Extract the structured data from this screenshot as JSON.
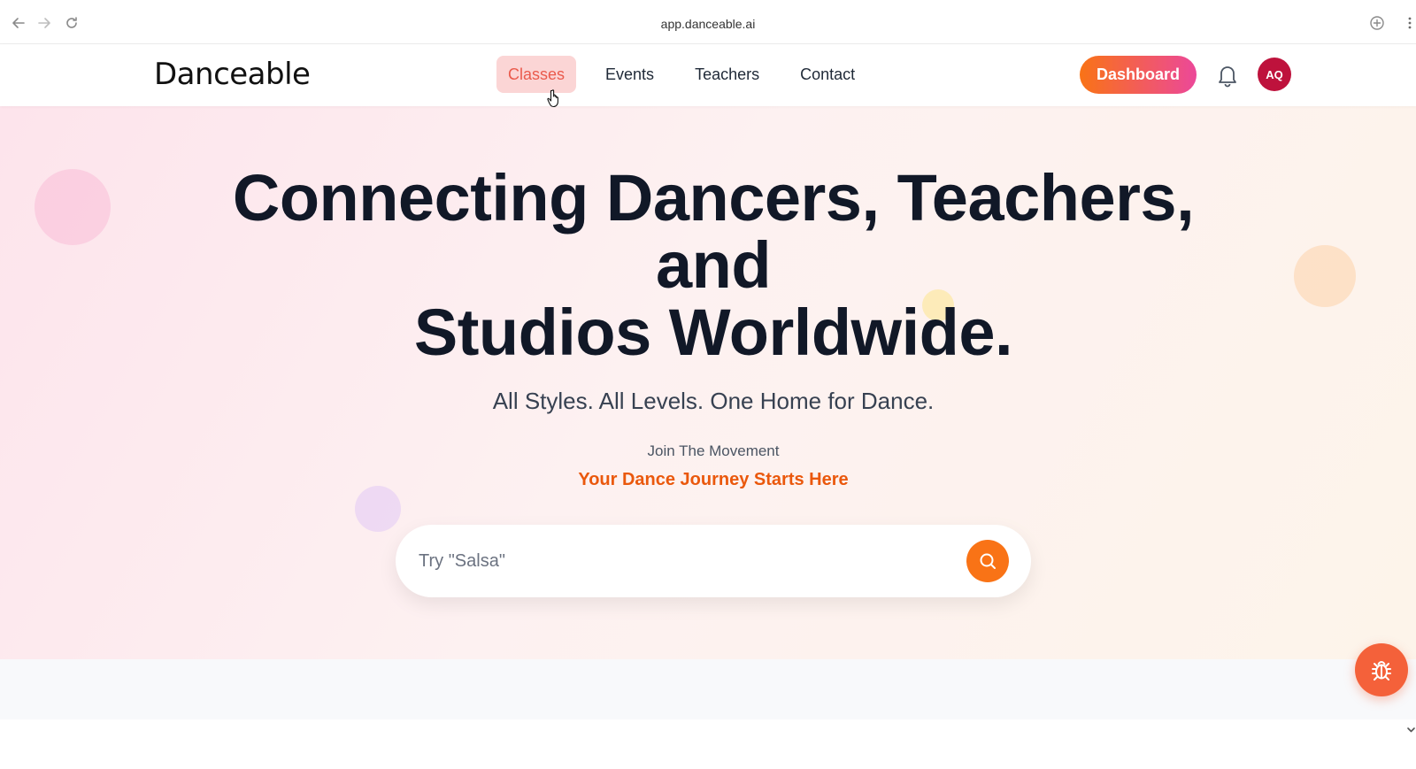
{
  "browser": {
    "url": "app.danceable.ai"
  },
  "header": {
    "logo": "Danceable",
    "nav": [
      {
        "label": "Classes",
        "active": true
      },
      {
        "label": "Events",
        "active": false
      },
      {
        "label": "Teachers",
        "active": false
      },
      {
        "label": "Contact",
        "active": false
      }
    ],
    "dashboard_label": "Dashboard",
    "avatar_initials": "AQ"
  },
  "hero": {
    "headline_line1": "Connecting Dancers, Teachers,",
    "headline_line2": "and",
    "headline_line3": "Studios Worldwide.",
    "subheadline": "All Styles. All Levels. One Home for Dance.",
    "kicker": "Join The Movement",
    "tagline": "Your Dance Journey Starts Here",
    "search_placeholder": "Try \"Salsa\""
  },
  "colors": {
    "accent_orange": "#f97316",
    "accent_pink": "#ec4899",
    "active_nav_bg": "#fbd5d5",
    "active_nav_text": "#ea5a4c",
    "avatar_bg": "#be123c",
    "bug_button": "#f4613a"
  },
  "icons": {
    "back": "arrow-left-icon",
    "forward": "arrow-right-icon",
    "reload": "reload-icon",
    "install": "install-icon",
    "menu": "kebab-menu-icon",
    "notifications": "bell-icon",
    "search": "search-icon",
    "bug_report": "bug-icon",
    "scroll": "chevron-down-icon"
  }
}
